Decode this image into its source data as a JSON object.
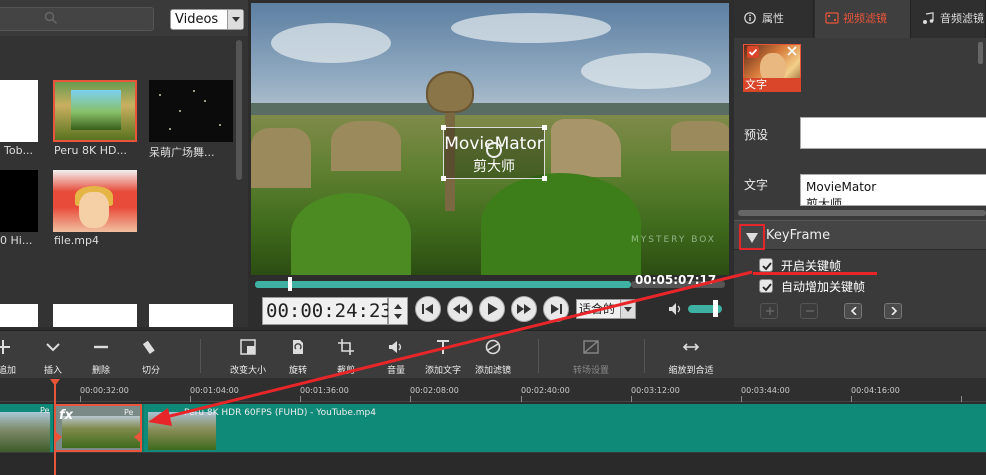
{
  "bin": {
    "filter_value": "Videos",
    "items": [
      {
        "label": "Tob..."
      },
      {
        "label": "Peru 8K HD..."
      },
      {
        "label": "呆萌广场舞..."
      },
      {
        "label": "0 Hi..."
      },
      {
        "label": "file.mp4"
      }
    ]
  },
  "viewer": {
    "overlay_line1": "MovieMator",
    "overlay_line2": "剪大师",
    "watermark": "MYSTERY BOX"
  },
  "transport": {
    "current_time": "00:00:24:23",
    "total_time": "00:05:07:17",
    "zoom_value": "适合的",
    "progress_fraction": 0.07,
    "volume_fraction": 0.8
  },
  "props": {
    "tabs": [
      {
        "label": "属性",
        "icon": "info-icon"
      },
      {
        "label": "视频滤镜",
        "icon": "video-filter-icon"
      },
      {
        "label": "音频滤镜",
        "icon": "audio-filter-icon"
      }
    ],
    "active_tab": 1,
    "filter_thumb_label": "文字",
    "preset_label": "预设",
    "preset_value": "",
    "text_label": "文字",
    "text_line1": "MovieMator",
    "text_line2": "剪大师",
    "keyframe_title": "KeyFrame",
    "keyframe_enable": "开启关键帧",
    "keyframe_auto": "自动增加关键帧"
  },
  "toolbar": {
    "tools": [
      {
        "label": "追加",
        "icon": "plus-icon"
      },
      {
        "label": "插入",
        "icon": "insert-icon"
      },
      {
        "label": "删除",
        "icon": "minus-icon"
      },
      {
        "label": "切分",
        "icon": "split-icon"
      },
      {
        "label": "改变大小",
        "icon": "resize-icon"
      },
      {
        "label": "旋转",
        "icon": "rotate-icon"
      },
      {
        "label": "裁剪",
        "icon": "crop-icon"
      },
      {
        "label": "音量",
        "icon": "volume-icon"
      },
      {
        "label": "添加文字",
        "icon": "text-icon"
      },
      {
        "label": "添加滤镜",
        "icon": "filter-icon"
      },
      {
        "label": "转场设置",
        "icon": "transition-icon"
      },
      {
        "label": "缩放到合适",
        "icon": "zoom-fit-icon"
      }
    ]
  },
  "timeline": {
    "ticks": [
      "00:00:32:00",
      "00:01:04:00",
      "00:01:36:00",
      "00:02:08:00",
      "00:02:40:00",
      "00:03:12:00",
      "00:03:44:00",
      "00:04:16:00"
    ],
    "clip_a_label": "Pe",
    "clip_b_fx": "fx",
    "clip_b_label": "Pe",
    "clip_c_label": "Peru 8K HDR 60FPS (FUHD) - YouTube.mp4"
  },
  "colors": {
    "accent": "#e8553a",
    "annotation_red": "#e8262a",
    "track_teal": "#0d7a6a"
  }
}
